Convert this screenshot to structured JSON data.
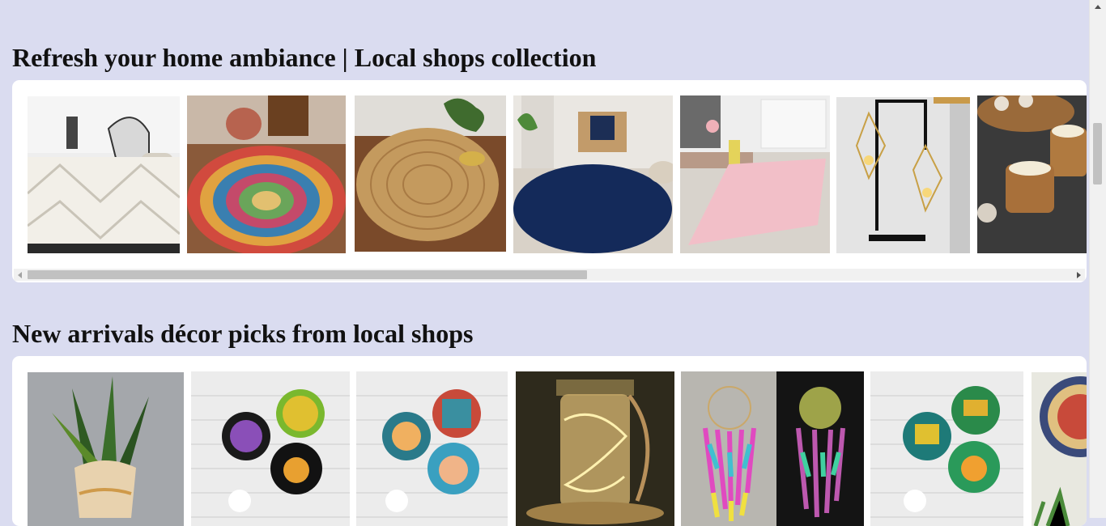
{
  "sections": [
    {
      "title": "Refresh your home ambiance | Local shops collection",
      "products": [
        {
          "name": "product-shaggy-diamond-rug"
        },
        {
          "name": "product-braided-multicolor-rug"
        },
        {
          "name": "product-round-jute-rug"
        },
        {
          "name": "product-navy-round-shag-rug"
        },
        {
          "name": "product-pink-runner-rug"
        },
        {
          "name": "product-geometric-candle-holder"
        },
        {
          "name": "product-wooden-tealight-holders"
        }
      ]
    },
    {
      "title": "New arrivals décor picks from local shops",
      "products": [
        {
          "name": "product-snake-plant-pot"
        },
        {
          "name": "product-wall-plates-set-1"
        },
        {
          "name": "product-wall-plates-set-2"
        },
        {
          "name": "product-fairy-light-jar"
        },
        {
          "name": "product-dreamcatcher"
        },
        {
          "name": "product-wall-plates-set-3"
        },
        {
          "name": "product-mandala-plate"
        }
      ]
    }
  ],
  "icons": {
    "scroll_left": "triangle-left-icon",
    "scroll_right": "triangle-right-icon",
    "scroll_up": "triangle-up-icon"
  },
  "colors": {
    "page_background": "#dadcf0",
    "card_background": "#ffffff",
    "scroll_thumb": "#c1c1c1"
  }
}
